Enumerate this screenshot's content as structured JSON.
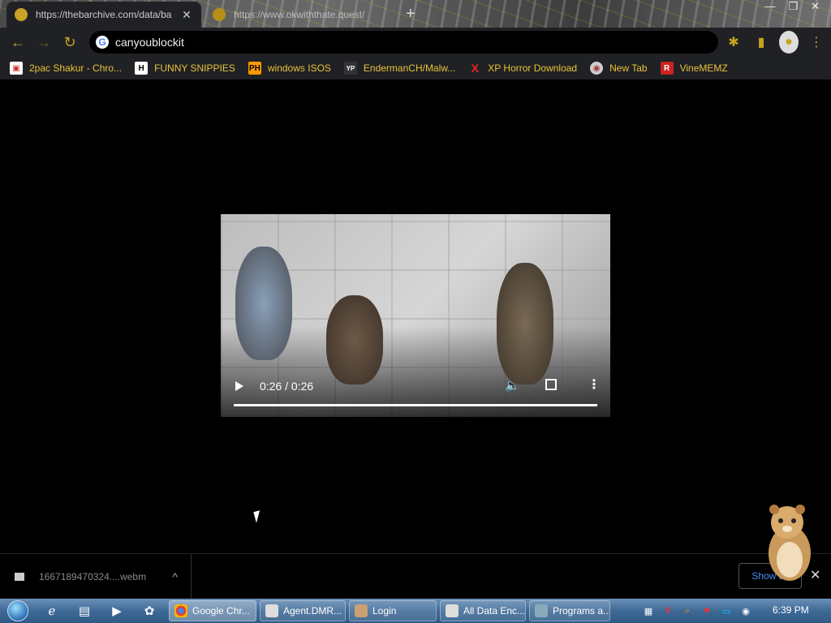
{
  "tabs": [
    {
      "title": "https://thebarchive.com/data/ba",
      "active": true
    },
    {
      "title": "https://www.okwiththate.quest/",
      "active": false
    }
  ],
  "toolbar": {
    "address": "canyoublockit"
  },
  "bookmarks": [
    {
      "label": "2pac Shakur - Chro...",
      "icon": "2pac-icon"
    },
    {
      "label": "FUNNY SNIPPIES",
      "icon_text": "H"
    },
    {
      "label": "windows ISOS",
      "icon_text": "PH"
    },
    {
      "label": "EndermanCH/Malw...",
      "icon_text": "YP"
    },
    {
      "label": "XP Horror Download",
      "icon_text": "X"
    },
    {
      "label": "New Tab",
      "icon": "globe-icon"
    },
    {
      "label": "VineMEMZ",
      "icon_text": "R"
    }
  ],
  "video": {
    "time": "0:26 / 0:26",
    "progress": 1.0
  },
  "downloads": {
    "file": "1667189470324....webm",
    "show_all": "Show all"
  },
  "taskbar": {
    "tasks": [
      {
        "label": "Google Chr...",
        "active": true
      },
      {
        "label": "Agent.DMR...",
        "active": false
      },
      {
        "label": "Login",
        "active": false
      },
      {
        "label": "All Data Enc...",
        "active": false
      },
      {
        "label": "Programs a...",
        "active": false
      }
    ],
    "clock": "6:39 PM"
  },
  "colors": {
    "accent": "#c7a21e",
    "bookmark_text": "#e8c23a",
    "download_link": "#4a8cf7"
  }
}
